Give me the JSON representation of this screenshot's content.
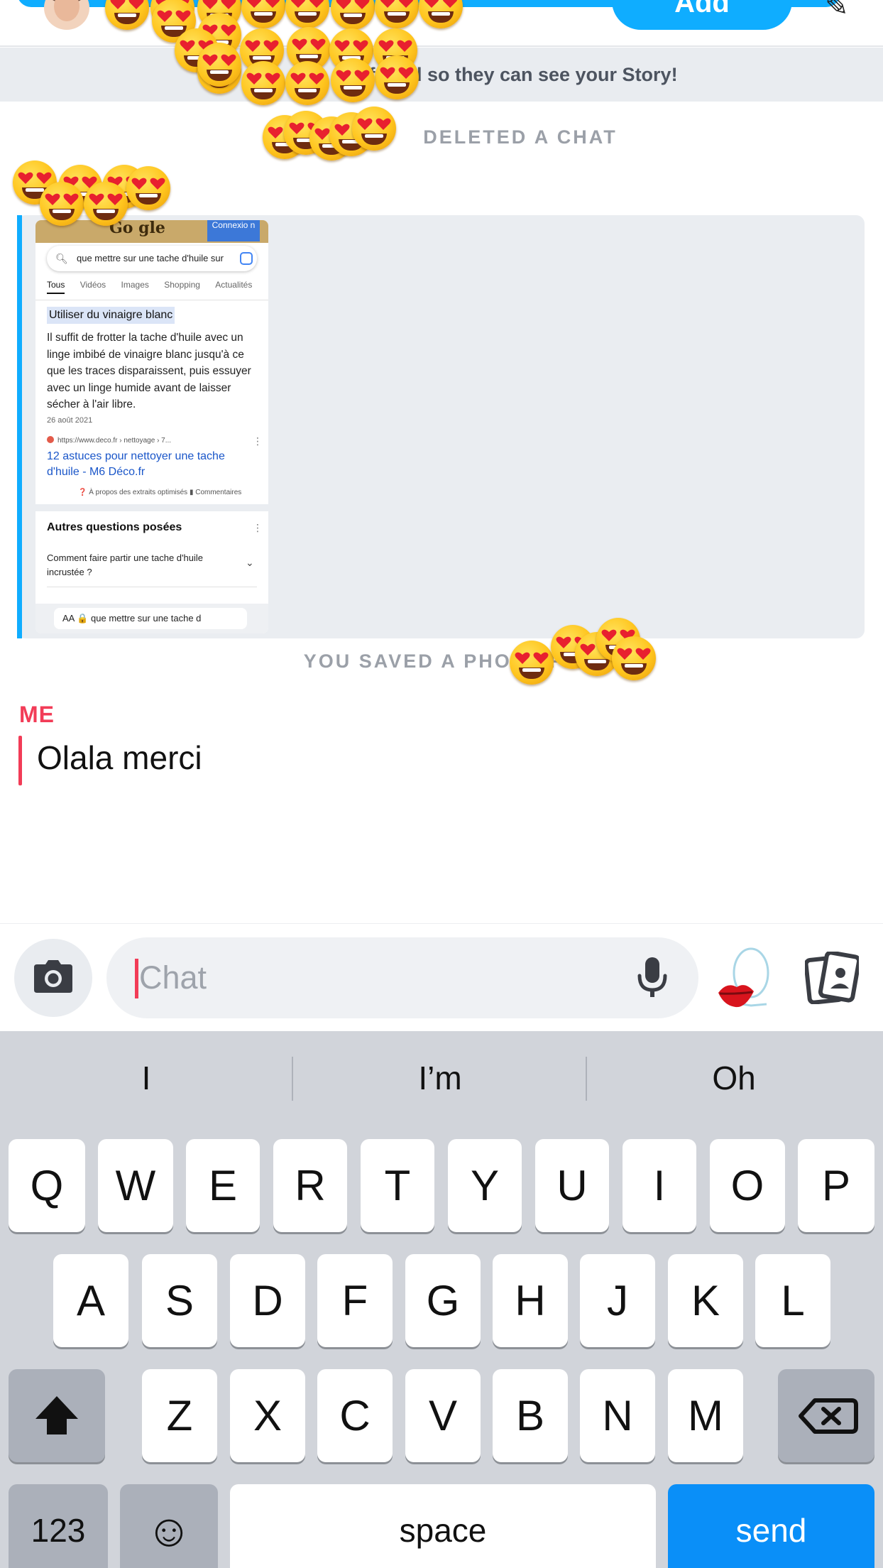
{
  "header": {
    "add_label": "Add",
    "options_glyph": "✎",
    "avatar_icon": "bitmoji-avatar"
  },
  "story_banner": {
    "text": "friend so they can see your Story!"
  },
  "system_messages": {
    "deleted": "DELETED A CHAT",
    "saved_photo": "YOU SAVED A PHOTO FR"
  },
  "photo_message": {
    "google_logo": "Go gle",
    "connect_label": "Connexio n",
    "search_query": "que mettre sur une tache d'huile sur",
    "tabs": [
      "Tous",
      "Vidéos",
      "Images",
      "Shopping",
      "Actualités"
    ],
    "highlight_heading": "Utiliser du vinaigre blanc",
    "snippet": "Il suffit de frotter la tache d'huile avec un linge imbibé de vinaigre blanc jusqu'à ce que les traces disparaissent, puis essuyer avec un linge humide avant de laisser sécher à l'air libre.",
    "date": "26 août 2021",
    "source_url": "https://www.deco.fr › nettoyage › 7...",
    "link_title": "12 astuces pour nettoyer une tache d'huile - M6 Déco.fr",
    "about_row": "❓ À propos des extraits optimisés    ▮ Commentaires",
    "paa_heading": "Autres questions posées",
    "paa_question": "Comment faire partir une tache d'huile incrustée ?",
    "address_bar": "AA  🔒 que mettre sur une tache d"
  },
  "me_message": {
    "sender": "ME",
    "text": "Olala merci"
  },
  "composer": {
    "placeholder": "Chat",
    "icons": [
      "camera-icon",
      "microphone-icon",
      "lips-icon",
      "cards-icon"
    ]
  },
  "keyboard": {
    "suggestions": [
      "I",
      "I’m",
      "Oh"
    ],
    "row1": [
      "Q",
      "W",
      "E",
      "R",
      "T",
      "Y",
      "U",
      "I",
      "O",
      "P"
    ],
    "row2": [
      "A",
      "S",
      "D",
      "F",
      "G",
      "H",
      "J",
      "K",
      "L"
    ],
    "row3": [
      "Z",
      "X",
      "C",
      "V",
      "B",
      "N",
      "M"
    ],
    "numbers_label": "123",
    "emoji_glyph": "☺",
    "space_label": "space",
    "send_label": "send"
  },
  "colors": {
    "accent_blue": "#0fadff",
    "me_red": "#f23c57",
    "send_blue": "#0a8ff8",
    "keyboard_bg": "#d1d4da"
  }
}
